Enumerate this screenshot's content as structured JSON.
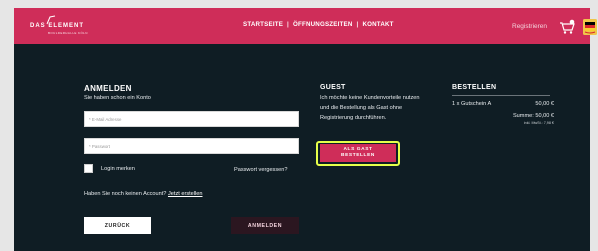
{
  "header": {
    "logo": {
      "brand_text": "DAS ELEMENT",
      "tagline": "BOULDERHALLE KÖLN"
    },
    "nav": {
      "home": "STARTSEITE",
      "separator": "|",
      "hours": "ÖFFNUNGSZEITEN",
      "contact": "KONTAKT"
    },
    "register_label": "Registrieren",
    "icons": {
      "cart": "cart-icon",
      "language": "flag-de-icon"
    },
    "colors": {
      "accent": "#cf2d59",
      "dark": "#0f1d24"
    }
  },
  "login": {
    "title": "ANMELDEN",
    "subtitle": "Sie haben schon ein Konto",
    "email_placeholder": "* E-Mail Adresse",
    "password_placeholder": "* Passwort",
    "remember_label": "Login merken",
    "forgot_label": "Passwort vergessen?",
    "no_account_text": "Haben Sie noch keinen Account?",
    "create_account_link": "Jetzt erstellen",
    "back_button": "ZURÜCK",
    "login_button": "ANMELDEN"
  },
  "guest": {
    "title": "GUEST",
    "text": "Ich möchte keine Kundenvorteile nutzen und die Bestellung als Gast ohne Registrierung durchführen.",
    "button_line1": "ALS GAST",
    "button_line2": "BESTELLEN"
  },
  "order": {
    "title": "BESTELLEN",
    "items": [
      {
        "name": "1 x Gutschein A",
        "price": "50,00 €"
      }
    ],
    "sum_label": "Summe: 50,00 €",
    "vat_label": "inkl. MwSt.: 7,98 €"
  }
}
